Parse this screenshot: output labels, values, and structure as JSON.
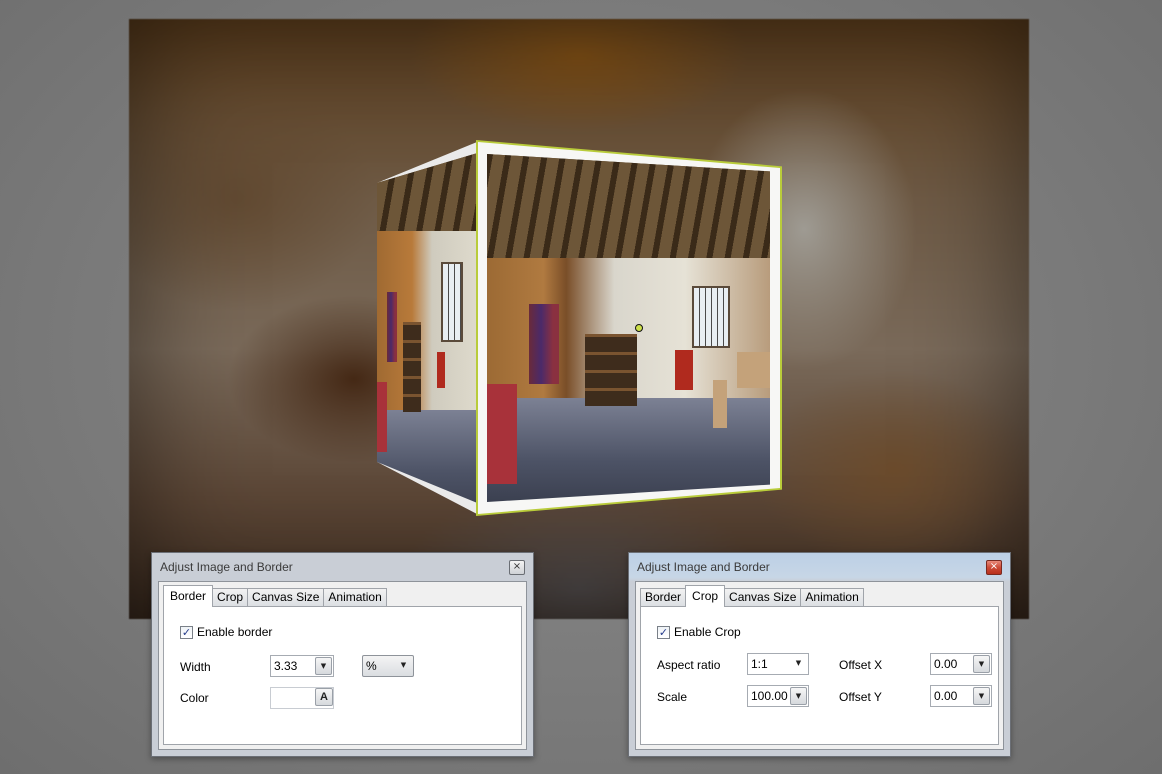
{
  "dialogs": [
    {
      "title": "Adjust Image and Border",
      "close_glyph": "×",
      "tabs": [
        "Border",
        "Crop",
        "Canvas Size",
        "Animation"
      ],
      "active_tab": "Border",
      "border_tab": {
        "enable_label": "Enable border",
        "enable_checked": true,
        "width_label": "Width",
        "width_value": "3.33",
        "unit_value": "%",
        "color_label": "Color",
        "color_button_glyph": "A"
      }
    },
    {
      "title": "Adjust Image and Border",
      "close_glyph": "×",
      "tabs": [
        "Border",
        "Crop",
        "Canvas Size",
        "Animation"
      ],
      "active_tab": "Crop",
      "crop_tab": {
        "enable_label": "Enable Crop",
        "enable_checked": true,
        "aspect_label": "Aspect ratio",
        "aspect_value": "1:1",
        "scale_label": "Scale",
        "scale_value": "100.00",
        "offset_x_label": "Offset X",
        "offset_x_value": "0.00",
        "offset_y_label": "Offset Y",
        "offset_y_value": "0.00"
      }
    }
  ],
  "glyphs": {
    "check": "✓",
    "dropdown": "▼"
  },
  "colors": {
    "cube_edge": "#b9cc3a",
    "close_red": "#cc4a36"
  },
  "icons": {
    "pivot": "pivot-handle-icon",
    "close": "close-icon",
    "dropdown": "chevron-down-icon",
    "check": "checkmark-icon"
  }
}
